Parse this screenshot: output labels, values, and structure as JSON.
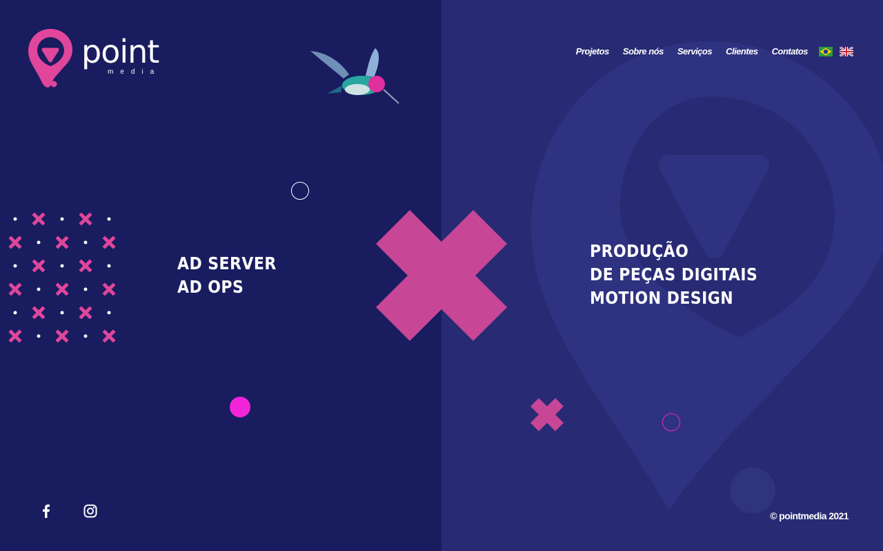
{
  "brand": {
    "name": "point",
    "tagline": "media",
    "pink": "#e0469b",
    "accent_x": "#c74696",
    "magenta": "#f226d8",
    "left_bg": "#191c5f",
    "right_bg": "#282b73"
  },
  "nav": {
    "items": [
      {
        "label": "Projetos"
      },
      {
        "label": "Sobre nós"
      },
      {
        "label": "Serviços"
      },
      {
        "label": "Clientes"
      },
      {
        "label": "Contatos"
      }
    ],
    "languages": [
      {
        "icon": "brazil-flag-icon"
      },
      {
        "icon": "uk-flag-icon"
      }
    ]
  },
  "left_section": {
    "lines": [
      "AD SERVER",
      "AD OPS"
    ]
  },
  "right_section": {
    "lines": [
      "PRODUÇÃO",
      "DE PEÇAS DIGITAIS",
      "MOTION DESIGN"
    ]
  },
  "social": [
    {
      "icon": "facebook-icon"
    },
    {
      "icon": "instagram-icon"
    }
  ],
  "footer": {
    "copyright": "© pointmedia 2021"
  }
}
